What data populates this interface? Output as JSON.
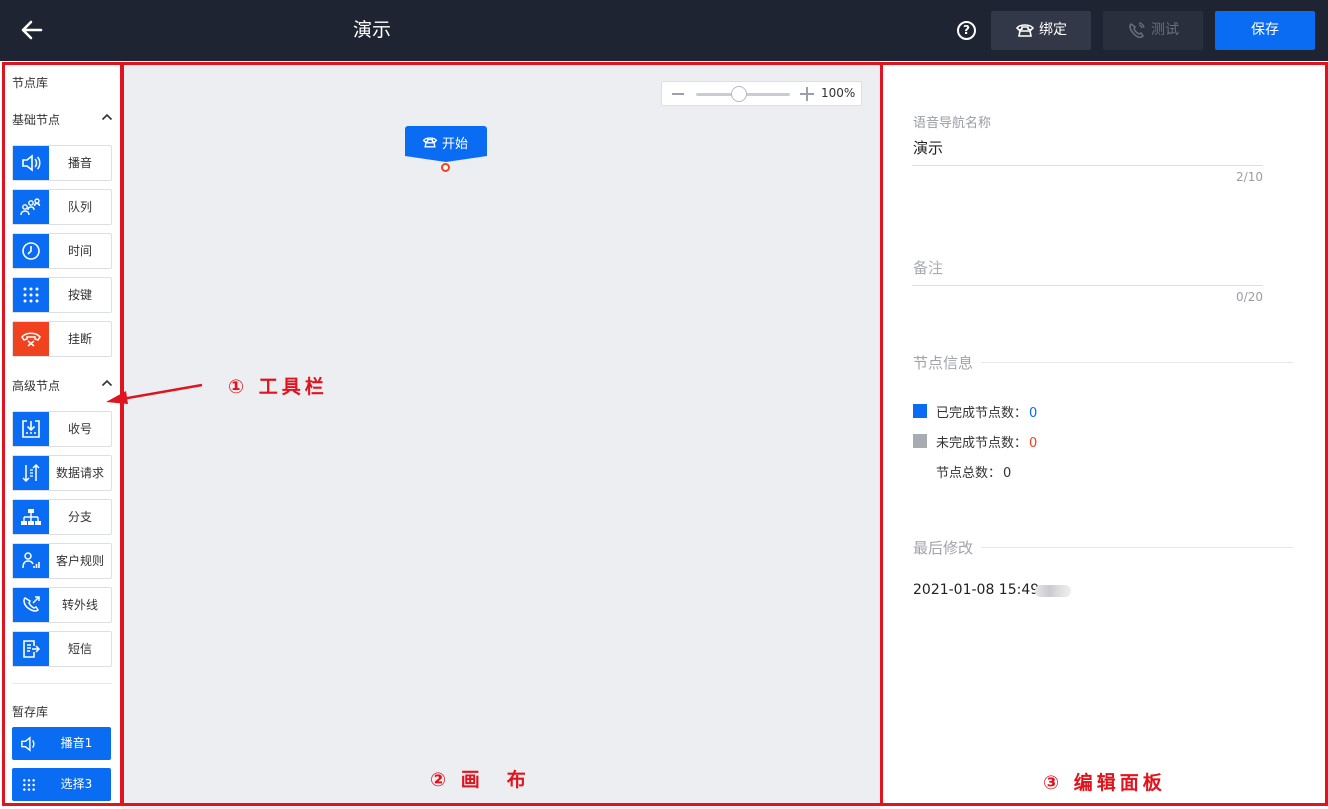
{
  "header": {
    "title": "演示",
    "help_symbol": "?",
    "bind_label": "绑定",
    "test_label": "测试",
    "save_label": "保存"
  },
  "sidebar": {
    "library_title": "节点库",
    "basic_title": "基础节点",
    "basic_nodes": [
      {
        "label": "播音",
        "icon": "speaker-icon"
      },
      {
        "label": "队列",
        "icon": "queue-people-icon"
      },
      {
        "label": "时间",
        "icon": "clock-icon"
      },
      {
        "label": "按键",
        "icon": "keypad-icon"
      },
      {
        "label": "挂断",
        "icon": "hangup-icon"
      }
    ],
    "advanced_title": "高级节点",
    "advanced_nodes": [
      {
        "label": "收号",
        "icon": "collect-digits-icon"
      },
      {
        "label": "数据请求",
        "icon": "data-request-icon"
      },
      {
        "label": "分支",
        "icon": "branch-icon"
      },
      {
        "label": "客户规则",
        "icon": "customer-rule-icon"
      },
      {
        "label": "转外线",
        "icon": "transfer-call-icon"
      },
      {
        "label": "短信",
        "icon": "sms-icon"
      }
    ],
    "stash_title": "暂存库",
    "stash_items": [
      {
        "label": "播音1",
        "icon": "speaker-icon"
      },
      {
        "label": "选择3",
        "icon": "keypad-icon"
      }
    ]
  },
  "canvas": {
    "zoom_value": "100%",
    "zoom_level": 1.0,
    "start_node_label": "开始"
  },
  "panel": {
    "name_label": "语音导航名称",
    "name_value": "演示",
    "name_count": "2/10",
    "remark_placeholder": "备注",
    "remark_count": "0/20",
    "node_info_title": "节点信息",
    "completed_label": "已完成节点数：",
    "completed_value": "0",
    "incomplete_label": "未完成节点数：",
    "incomplete_value": "0",
    "total_label": "节点总数：",
    "total_value": "0",
    "last_modified_title": "最后修改",
    "last_modified_value": "2021-01-08 15:49"
  },
  "annotations": {
    "toolbar": "① 工具栏",
    "canvas": "② 画　布",
    "editor": "③ 编辑面板"
  },
  "colors": {
    "header_bg": "#1f2432",
    "accent": "#0a6cf2",
    "danger": "#f0421f",
    "canvas_bg": "#edeef2",
    "annotation": "#e0141e",
    "completed": "#0a6cf2",
    "incomplete": "#a8abb2"
  }
}
